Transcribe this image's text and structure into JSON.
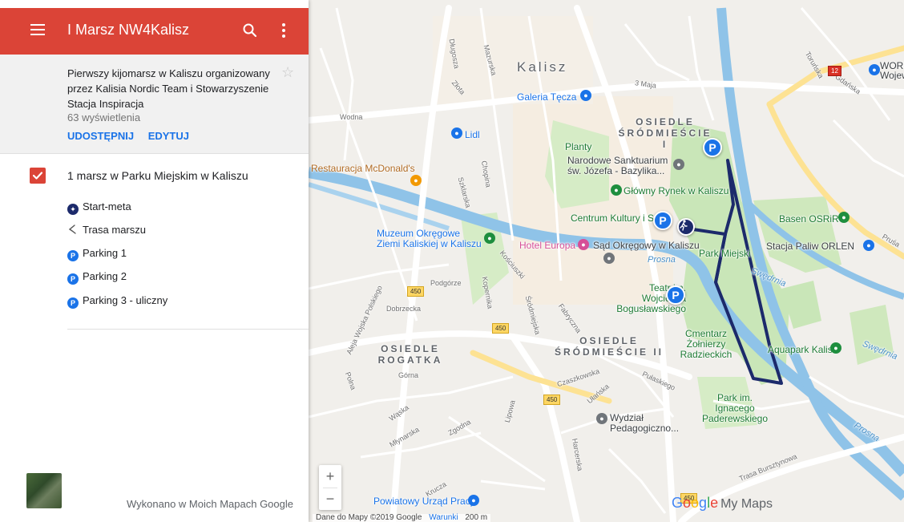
{
  "app": {
    "title": "I Marsz NW4Kalisz",
    "description": "Pierwszy kijomarsz w Kaliszu organizowany przez Kalisia Nordic Team i Stowarzyszenie Stacja Inspiracja",
    "views": "63 wyświetlenia",
    "share_label": "UDOSTĘPNIJ",
    "edit_label": "EDYTUJ",
    "footer": "Wykonano w Moich Mapach Google"
  },
  "layer": {
    "title": "1 marsz w Parku Miejskim w Kaliszu",
    "checked": true,
    "items": [
      {
        "label": "Start-meta",
        "icon": "walker-icon"
      },
      {
        "label": "Trasa marszu",
        "icon": "route-line-icon"
      },
      {
        "label": "Parking 1",
        "icon": "parking-icon"
      },
      {
        "label": "Parking 2",
        "icon": "parking-icon"
      },
      {
        "label": "Parking 3 - uliczny",
        "icon": "parking-icon"
      }
    ]
  },
  "map": {
    "city": "Kalisz",
    "districts": [
      "OSIEDLE ŚRÓDMIEŚCIE I",
      "OSIEDLE ŚRÓDMIEŚCIE II",
      "OSIEDLE ROGATKA"
    ],
    "labels": {
      "galeria": "Galeria Tęcza",
      "lidl": "Lidl",
      "mcdonalds": "Restauracja McDonald's",
      "planty": "Planty",
      "sanktuarium": "Narodowe Sanktuarium św. Józefa - Bazylika...",
      "rynek": "Główny Rynek w Kaliszu",
      "centrum": "Centrum Kultury i S...",
      "muzeum": "Muzeum Okręgowe Ziemi Kaliskiej w Kaliszu",
      "hotel": "Hotel Europa",
      "sad": "Sąd Okręgowy w Kaliszu",
      "park": "Park Miejski",
      "teatr": "Teatr im. Wojciecha Bogusławskiego",
      "basen": "Basen OSRiR",
      "orlen": "Stacja Paliw ORLEN",
      "cmentarz": "Cmentarz Żołnierzy Radzieckich",
      "aquapark": "Aquapark Kalisz",
      "paderewski": "Park im. Ignacego Paderewskiego",
      "wydzial": "Wydział Pedagogiczno...",
      "urzad": "Powiatowy Urząd Pracy",
      "word": "WORD Wojew...",
      "prosna": "Prosna",
      "swedrnia": "Swędrnia",
      "swedrnia2": "Swędrnia",
      "prosna2": "Prosna"
    },
    "streets": [
      "Złota",
      "3 Maja",
      "Wodna",
      "Podgórze",
      "Dobrzecka",
      "Górna",
      "Polna",
      "Wąska",
      "Młynarska",
      "Zgodna",
      "Czaszkowska",
      "Ułańska",
      "Pułaskiego",
      "Kościuszki",
      "Śródmiejska",
      "Fabryczna",
      "Trasa Bursztynowa",
      "Aleja Wojska Polskiego",
      "Gdańska",
      "Toruńska",
      "Długosza",
      "Mazurska",
      "Krucza",
      "Lipowa",
      "Kopernika",
      "Harcerska",
      "Chopina",
      "Szklarska",
      "Pruśa"
    ],
    "road_numbers": {
      "r1": "12",
      "r2": "450",
      "r3": "450",
      "r4": "450",
      "r5": "450"
    },
    "zoom_in": "+",
    "zoom_out": "−",
    "attribution": "Dane do Mapy ©2019 Google",
    "terms": "Warunki",
    "scale": "200 m",
    "brand_text": "My Maps"
  },
  "colors": {
    "header_red": "#db4437",
    "accent_blue": "#1a73e8",
    "route": "#1c2a6b"
  }
}
